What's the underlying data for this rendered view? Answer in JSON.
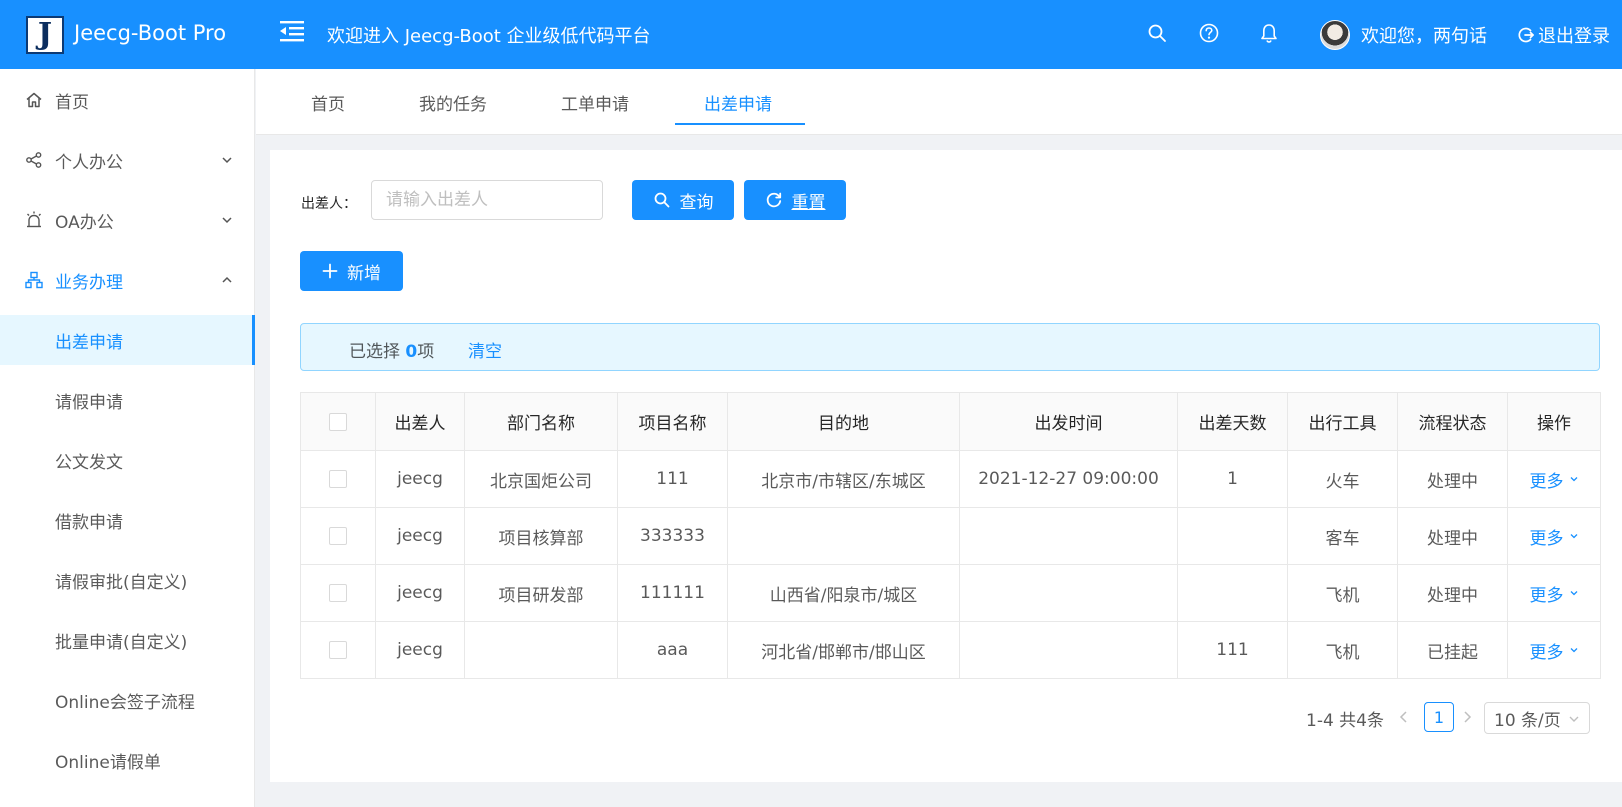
{
  "header": {
    "logo_letter": "J",
    "brand": "Jeecg-Boot Pro",
    "welcome": "欢迎进入 Jeecg-Boot 企业级低代码平台",
    "icons": [
      "menu-fold-icon",
      "search-icon",
      "help-icon",
      "bell-icon"
    ],
    "user_greeting": "欢迎您，两句话",
    "logout": "退出登录"
  },
  "sidebar": {
    "items": [
      {
        "label": "首页",
        "icon": "home-icon"
      },
      {
        "label": "个人办公",
        "icon": "share-icon"
      },
      {
        "label": "OA办公",
        "icon": "alarm-icon"
      },
      {
        "label": "业务办理",
        "icon": "cluster-icon"
      }
    ],
    "sub_items": [
      {
        "label": "出差申请"
      },
      {
        "label": "请假申请"
      },
      {
        "label": "公文发文"
      },
      {
        "label": "借款申请"
      },
      {
        "label": "请假审批(自定义)"
      },
      {
        "label": "批量申请(自定义)"
      },
      {
        "label": "Online会签子流程"
      },
      {
        "label": "Online请假单"
      }
    ]
  },
  "tabs": [
    {
      "label": "首页"
    },
    {
      "label": "我的任务"
    },
    {
      "label": "工单申请"
    },
    {
      "label": "出差申请"
    }
  ],
  "search": {
    "label": "出差人：",
    "placeholder": "请输入出差人",
    "query_button": "查询",
    "reset_button": "重置"
  },
  "toolbar": {
    "add_button": "新增"
  },
  "selection": {
    "prefix": "已选择 ",
    "count": "0",
    "suffix": "项",
    "clear": "清空"
  },
  "table": {
    "columns": [
      "出差人",
      "部门名称",
      "项目名称",
      "目的地",
      "出发时间",
      "出差天数",
      "出行工具",
      "流程状态",
      "操作"
    ],
    "rows": [
      {
        "person": "jeecg",
        "dept": "北京国炬公司",
        "project": "111",
        "destination": "北京市/市辖区/东城区",
        "depart": "2021-12-27 09:00:00",
        "days": "1",
        "transport": "火车",
        "status": "处理中",
        "action": "更多"
      },
      {
        "person": "jeecg",
        "dept": "项目核算部",
        "project": "333333",
        "destination": "",
        "depart": "",
        "days": "",
        "transport": "客车",
        "status": "处理中",
        "action": "更多"
      },
      {
        "person": "jeecg",
        "dept": "项目研发部",
        "project": "111111",
        "destination": "山西省/阳泉市/城区",
        "depart": "",
        "days": "",
        "transport": "飞机",
        "status": "处理中",
        "action": "更多"
      },
      {
        "person": "jeecg",
        "dept": "",
        "project": "aaa",
        "destination": "河北省/邯郸市/邯山区",
        "depart": "",
        "days": "111",
        "transport": "飞机",
        "status": "已挂起",
        "action": "更多"
      }
    ]
  },
  "pagination": {
    "total": "1-4 共4条",
    "current": "1",
    "page_size": "10 条/页"
  },
  "colors": {
    "primary": "#1890ff",
    "header_bg": "#1890ff",
    "selected_bg": "#e6f7ff"
  }
}
